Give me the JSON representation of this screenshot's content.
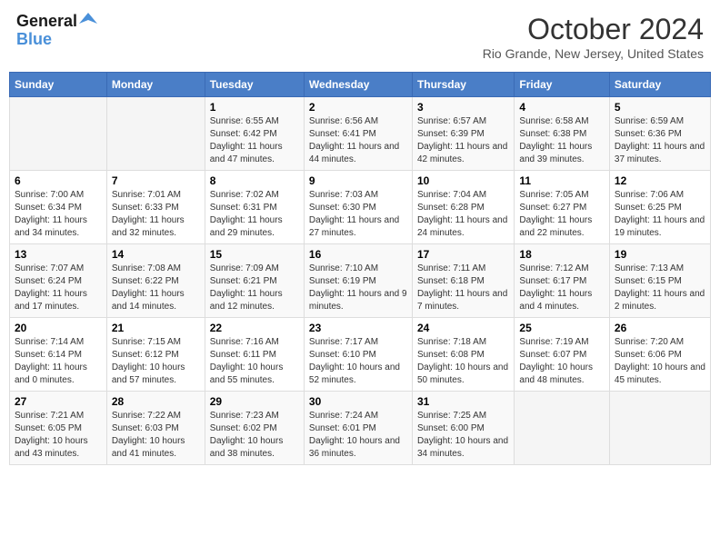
{
  "header": {
    "logo_line1": "General",
    "logo_line2": "Blue",
    "month_title": "October 2024",
    "location": "Rio Grande, New Jersey, United States"
  },
  "days_of_week": [
    "Sunday",
    "Monday",
    "Tuesday",
    "Wednesday",
    "Thursday",
    "Friday",
    "Saturday"
  ],
  "weeks": [
    [
      {
        "day": "",
        "sunrise": "",
        "sunset": "",
        "daylight": ""
      },
      {
        "day": "",
        "sunrise": "",
        "sunset": "",
        "daylight": ""
      },
      {
        "day": "1",
        "sunrise": "Sunrise: 6:55 AM",
        "sunset": "Sunset: 6:42 PM",
        "daylight": "Daylight: 11 hours and 47 minutes."
      },
      {
        "day": "2",
        "sunrise": "Sunrise: 6:56 AM",
        "sunset": "Sunset: 6:41 PM",
        "daylight": "Daylight: 11 hours and 44 minutes."
      },
      {
        "day": "3",
        "sunrise": "Sunrise: 6:57 AM",
        "sunset": "Sunset: 6:39 PM",
        "daylight": "Daylight: 11 hours and 42 minutes."
      },
      {
        "day": "4",
        "sunrise": "Sunrise: 6:58 AM",
        "sunset": "Sunset: 6:38 PM",
        "daylight": "Daylight: 11 hours and 39 minutes."
      },
      {
        "day": "5",
        "sunrise": "Sunrise: 6:59 AM",
        "sunset": "Sunset: 6:36 PM",
        "daylight": "Daylight: 11 hours and 37 minutes."
      }
    ],
    [
      {
        "day": "6",
        "sunrise": "Sunrise: 7:00 AM",
        "sunset": "Sunset: 6:34 PM",
        "daylight": "Daylight: 11 hours and 34 minutes."
      },
      {
        "day": "7",
        "sunrise": "Sunrise: 7:01 AM",
        "sunset": "Sunset: 6:33 PM",
        "daylight": "Daylight: 11 hours and 32 minutes."
      },
      {
        "day": "8",
        "sunrise": "Sunrise: 7:02 AM",
        "sunset": "Sunset: 6:31 PM",
        "daylight": "Daylight: 11 hours and 29 minutes."
      },
      {
        "day": "9",
        "sunrise": "Sunrise: 7:03 AM",
        "sunset": "Sunset: 6:30 PM",
        "daylight": "Daylight: 11 hours and 27 minutes."
      },
      {
        "day": "10",
        "sunrise": "Sunrise: 7:04 AM",
        "sunset": "Sunset: 6:28 PM",
        "daylight": "Daylight: 11 hours and 24 minutes."
      },
      {
        "day": "11",
        "sunrise": "Sunrise: 7:05 AM",
        "sunset": "Sunset: 6:27 PM",
        "daylight": "Daylight: 11 hours and 22 minutes."
      },
      {
        "day": "12",
        "sunrise": "Sunrise: 7:06 AM",
        "sunset": "Sunset: 6:25 PM",
        "daylight": "Daylight: 11 hours and 19 minutes."
      }
    ],
    [
      {
        "day": "13",
        "sunrise": "Sunrise: 7:07 AM",
        "sunset": "Sunset: 6:24 PM",
        "daylight": "Daylight: 11 hours and 17 minutes."
      },
      {
        "day": "14",
        "sunrise": "Sunrise: 7:08 AM",
        "sunset": "Sunset: 6:22 PM",
        "daylight": "Daylight: 11 hours and 14 minutes."
      },
      {
        "day": "15",
        "sunrise": "Sunrise: 7:09 AM",
        "sunset": "Sunset: 6:21 PM",
        "daylight": "Daylight: 11 hours and 12 minutes."
      },
      {
        "day": "16",
        "sunrise": "Sunrise: 7:10 AM",
        "sunset": "Sunset: 6:19 PM",
        "daylight": "Daylight: 11 hours and 9 minutes."
      },
      {
        "day": "17",
        "sunrise": "Sunrise: 7:11 AM",
        "sunset": "Sunset: 6:18 PM",
        "daylight": "Daylight: 11 hours and 7 minutes."
      },
      {
        "day": "18",
        "sunrise": "Sunrise: 7:12 AM",
        "sunset": "Sunset: 6:17 PM",
        "daylight": "Daylight: 11 hours and 4 minutes."
      },
      {
        "day": "19",
        "sunrise": "Sunrise: 7:13 AM",
        "sunset": "Sunset: 6:15 PM",
        "daylight": "Daylight: 11 hours and 2 minutes."
      }
    ],
    [
      {
        "day": "20",
        "sunrise": "Sunrise: 7:14 AM",
        "sunset": "Sunset: 6:14 PM",
        "daylight": "Daylight: 11 hours and 0 minutes."
      },
      {
        "day": "21",
        "sunrise": "Sunrise: 7:15 AM",
        "sunset": "Sunset: 6:12 PM",
        "daylight": "Daylight: 10 hours and 57 minutes."
      },
      {
        "day": "22",
        "sunrise": "Sunrise: 7:16 AM",
        "sunset": "Sunset: 6:11 PM",
        "daylight": "Daylight: 10 hours and 55 minutes."
      },
      {
        "day": "23",
        "sunrise": "Sunrise: 7:17 AM",
        "sunset": "Sunset: 6:10 PM",
        "daylight": "Daylight: 10 hours and 52 minutes."
      },
      {
        "day": "24",
        "sunrise": "Sunrise: 7:18 AM",
        "sunset": "Sunset: 6:08 PM",
        "daylight": "Daylight: 10 hours and 50 minutes."
      },
      {
        "day": "25",
        "sunrise": "Sunrise: 7:19 AM",
        "sunset": "Sunset: 6:07 PM",
        "daylight": "Daylight: 10 hours and 48 minutes."
      },
      {
        "day": "26",
        "sunrise": "Sunrise: 7:20 AM",
        "sunset": "Sunset: 6:06 PM",
        "daylight": "Daylight: 10 hours and 45 minutes."
      }
    ],
    [
      {
        "day": "27",
        "sunrise": "Sunrise: 7:21 AM",
        "sunset": "Sunset: 6:05 PM",
        "daylight": "Daylight: 10 hours and 43 minutes."
      },
      {
        "day": "28",
        "sunrise": "Sunrise: 7:22 AM",
        "sunset": "Sunset: 6:03 PM",
        "daylight": "Daylight: 10 hours and 41 minutes."
      },
      {
        "day": "29",
        "sunrise": "Sunrise: 7:23 AM",
        "sunset": "Sunset: 6:02 PM",
        "daylight": "Daylight: 10 hours and 38 minutes."
      },
      {
        "day": "30",
        "sunrise": "Sunrise: 7:24 AM",
        "sunset": "Sunset: 6:01 PM",
        "daylight": "Daylight: 10 hours and 36 minutes."
      },
      {
        "day": "31",
        "sunrise": "Sunrise: 7:25 AM",
        "sunset": "Sunset: 6:00 PM",
        "daylight": "Daylight: 10 hours and 34 minutes."
      },
      {
        "day": "",
        "sunrise": "",
        "sunset": "",
        "daylight": ""
      },
      {
        "day": "",
        "sunrise": "",
        "sunset": "",
        "daylight": ""
      }
    ]
  ]
}
